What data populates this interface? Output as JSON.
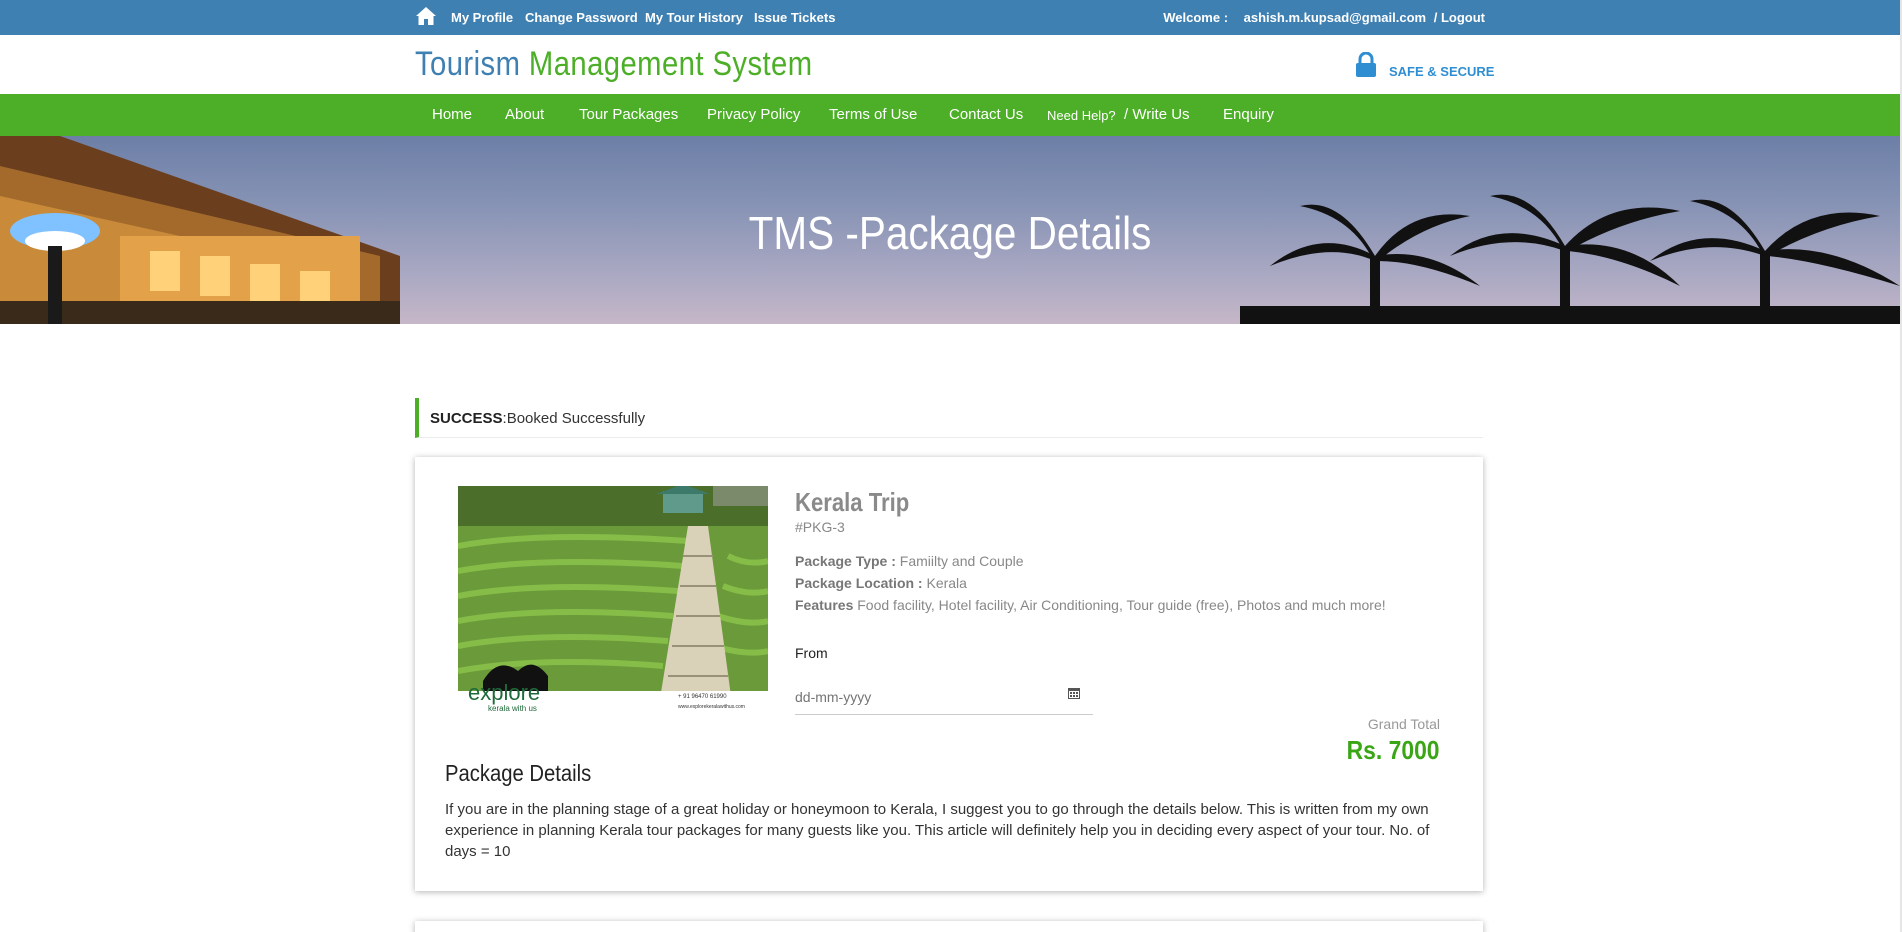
{
  "topbar": {
    "links": [
      "My Profile",
      "Change Password",
      "My Tour History",
      "Issue Tickets"
    ],
    "welcome_label": "Welcome :",
    "user_email": "ashish.m.kupsad@gmail.com",
    "logout": "/ Logout"
  },
  "header": {
    "logo_part1": "Tourism",
    "logo_part2": "Management System",
    "secure_text": "SAFE & SECURE"
  },
  "nav": {
    "items": [
      "Home",
      "About",
      "Tour Packages",
      "Privacy Policy",
      "Terms of Use",
      "Contact Us"
    ],
    "need_help": "Need Help?",
    "write_us": "/ Write Us",
    "enquiry": "Enquiry"
  },
  "banner": {
    "title": "TMS -Package Details"
  },
  "alert": {
    "label": "SUCCESS",
    "message": ":Booked Successfully"
  },
  "package": {
    "name": "Kerala Trip",
    "id": "#PKG-3",
    "type_label": "Package Type :",
    "type_value": "Famiilty and Couple",
    "location_label": "Package Location :",
    "location_value": "Kerala",
    "features_label": "Features",
    "features_value": "Food facility, Hotel facility, Air Conditioning, Tour guide (free), Photos and much more!",
    "from_label": "From",
    "date_placeholder": "dd-mm-yyyy",
    "grand_total_label": "Grand Total",
    "grand_total_value": "Rs. 7000",
    "details_heading": "Package Details",
    "details_text": "If you are in the planning stage of a great holiday or honeymoon to Kerala, I suggest you to go through the details below. This is written from my own experience in planning Kerala tour packages for many guests like you. This article will definitely help you in deciding every aspect of your tour. No. of days = 10",
    "image_logo_text": "explore",
    "image_sub_text": "kerala with us",
    "image_contact": "+ 91 96470 61990",
    "image_url_text": "www.explorekeralawithus.com"
  },
  "colors": {
    "topbar_blue": "#3f80b3",
    "nav_green": "#4caf27",
    "price_green": "#3aa616",
    "secure_blue": "#2f8ed1"
  }
}
